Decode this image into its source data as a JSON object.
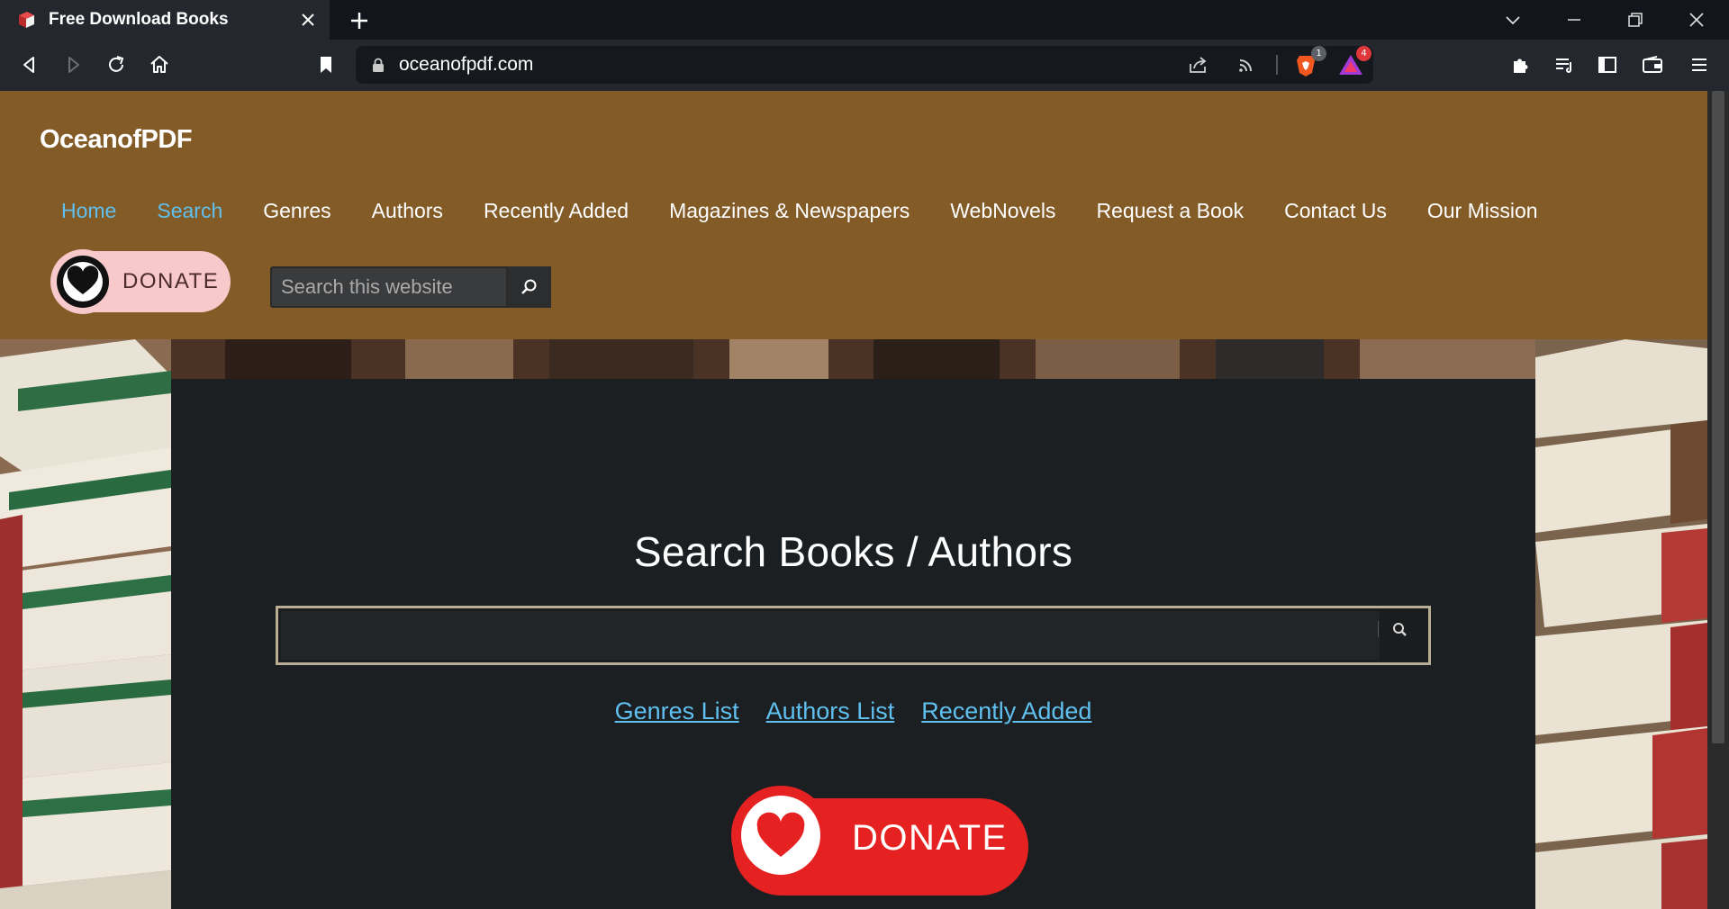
{
  "browser": {
    "tab_title": "Free Download Books",
    "url": "oceanofpdf.com",
    "brave_badge_count": "1",
    "rewards_badge_count": "4"
  },
  "site": {
    "title": "OceanofPDF",
    "nav": [
      "Home",
      "Search",
      "Genres",
      "Authors",
      "Recently Added",
      "Magazines & Newspapers",
      "WebNovels",
      "Request a Book",
      "Contact Us",
      "Our Mission"
    ],
    "donate_label": "DONATE",
    "header_search_placeholder": "Search this website"
  },
  "main": {
    "heading": "Search Books / Authors",
    "search_value": "",
    "links": [
      "Genres List",
      "Authors List",
      "Recently Added"
    ],
    "donate_label": "DONATE"
  },
  "colors": {
    "header_bg": "#835b27",
    "link": "#5fc0f0",
    "panel_bg": "#1c1f21",
    "donate_red": "#e52221",
    "donate_pink": "#f8c9cb"
  },
  "icons": {
    "tab_favicon": "book-icon",
    "nav_back": "back-arrow-icon",
    "nav_forward": "forward-arrow-icon",
    "reload": "reload-icon",
    "home": "home-icon",
    "bookmark": "bookmark-icon",
    "lock": "lock-icon",
    "share": "share-icon",
    "rss": "rss-icon",
    "brave_shields": "brave-lion-icon",
    "brave_rewards": "triangle-rewards-icon",
    "extensions": "puzzle-icon",
    "media": "playlist-icon",
    "sidebar": "sidebar-icon",
    "wallet": "wallet-icon",
    "menu": "hamburger-icon",
    "search": "search-icon",
    "donate": "heart-icon"
  }
}
